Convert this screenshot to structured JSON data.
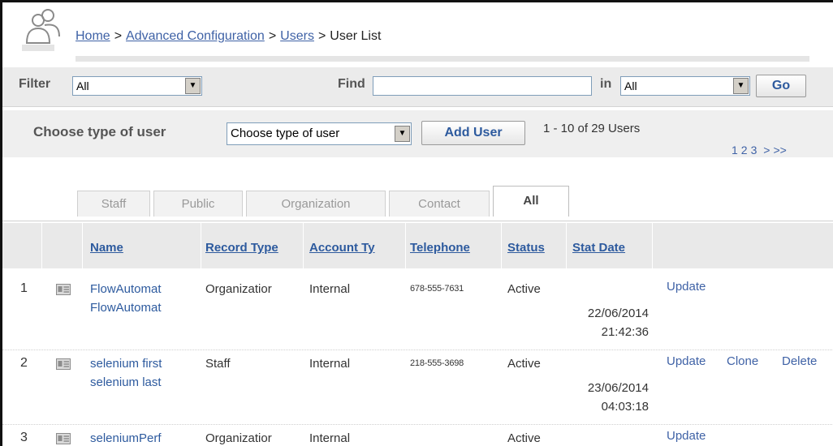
{
  "breadcrumb": {
    "home": "Home",
    "advanced": "Advanced Configuration",
    "users": "Users",
    "current": "User List",
    "separator": ">"
  },
  "filter": {
    "filter_label": "Filter",
    "filter_value": "All",
    "find_label": "Find",
    "find_value": "",
    "in_label": "in",
    "in_value": "All",
    "go_label": "Go"
  },
  "typebar": {
    "choose_label": "Choose type of user",
    "choose_value": "Choose type of user",
    "add_user_label": "Add User",
    "count_text": "1 - 10 of 29 Users",
    "pages": [
      "1",
      "2",
      "3",
      ">",
      ">>"
    ]
  },
  "tabs": [
    "Staff",
    "Public",
    "Organization",
    "Contact",
    "All"
  ],
  "active_tab": "All",
  "table": {
    "headers": [
      "Name",
      "Record Type",
      "Account Type",
      "Telephone",
      "Status",
      "Stat Date"
    ],
    "header_display": [
      "Name",
      "Record Type",
      "Account Ty",
      "Telephone",
      "Status",
      "Stat Date"
    ],
    "rows": [
      {
        "num": "1",
        "name_line1": "FlowAutomat",
        "name_line2": "FlowAutomat",
        "record_type": "Organizatior",
        "account_type": "Internal",
        "telephone": "678-555-7631",
        "status": "Active",
        "date": "22/06/2014",
        "time": "21:42:36",
        "actions": [
          "Update"
        ]
      },
      {
        "num": "2",
        "name_line1": "selenium first",
        "name_line2": "selenium last",
        "record_type": "Staff",
        "account_type": "Internal",
        "telephone": "218-555-3698",
        "status": "Active",
        "date": "23/06/2014",
        "time": "04:03:18",
        "actions": [
          "Update",
          "Clone",
          "Delete"
        ]
      },
      {
        "num": "3",
        "name_line1": "seleniumPerf",
        "name_line2": "",
        "record_type": "Organizatior",
        "account_type": "Internal",
        "telephone": "",
        "status": "Active",
        "date": "",
        "time": "",
        "actions": [
          "Update"
        ]
      }
    ]
  },
  "colors": {
    "link": "#3f62a6",
    "header_link": "#2d5a9e",
    "bar_bg": "#ebebeb"
  },
  "icons": [
    "users-icon",
    "dropdown-arrow-icon",
    "contact-card-icon"
  ]
}
